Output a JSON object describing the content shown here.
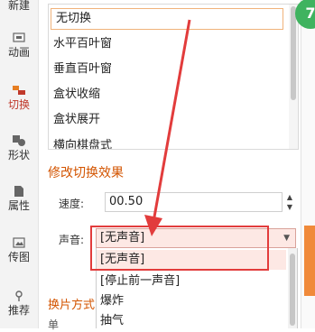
{
  "rail": {
    "items": [
      {
        "label": "新建",
        "icon": "new-icon"
      },
      {
        "label": "动画",
        "icon": "animation-icon"
      },
      {
        "label": "切换",
        "icon": "transition-icon",
        "active": true
      },
      {
        "label": "形状",
        "icon": "shape-icon"
      },
      {
        "label": "属性",
        "icon": "properties-icon"
      },
      {
        "label": "传图",
        "icon": "upload-image-icon"
      },
      {
        "label": "推荐",
        "icon": "recommend-icon"
      }
    ]
  },
  "effects": {
    "items": [
      "无切换",
      "水平百叶窗",
      "垂直百叶窗",
      "盒状收缩",
      "盒状展开",
      "横向棋盘式"
    ],
    "selected": "无切换"
  },
  "modify": {
    "title": "修改切换效果",
    "speed_label": "速度:",
    "speed_value": "00.50",
    "sound_label": "声音:",
    "sound_value": "[无声音]",
    "sound_options": [
      "[无声音]",
      "[停止前一声音]",
      "爆炸",
      "抽气"
    ],
    "sound_highlight": "[无声音]"
  },
  "scheme_label": "换片方式",
  "apply_label": "单",
  "badge": "7",
  "colors": {
    "accent": "#d35400",
    "highlight_box": "#e23c3c",
    "badge": "#3fb35f",
    "tab": "#f08a3a"
  }
}
